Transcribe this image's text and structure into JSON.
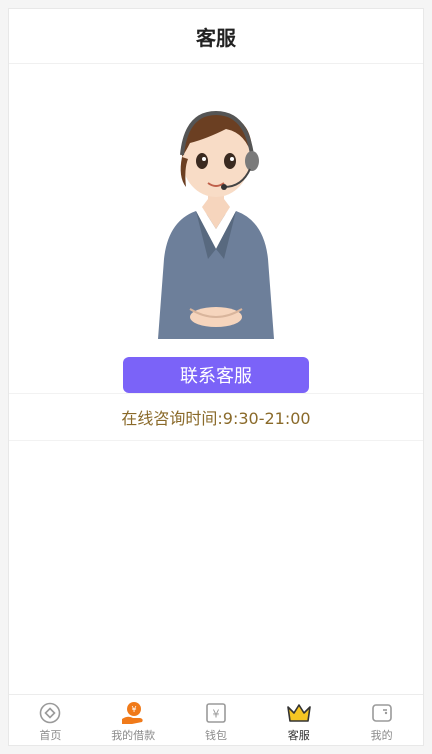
{
  "header": {
    "title": "客服"
  },
  "main": {
    "contact_button": "联系客服",
    "service_hours": "在线咨询时间:9:30-21:00"
  },
  "tabbar": {
    "items": [
      {
        "label": "首页",
        "icon": "home-icon",
        "active": false
      },
      {
        "label": "我的借款",
        "icon": "loan-icon",
        "active": false
      },
      {
        "label": "钱包",
        "icon": "wallet-icon",
        "active": false
      },
      {
        "label": "客服",
        "icon": "crown-icon",
        "active": true
      },
      {
        "label": "我的",
        "icon": "profile-icon",
        "active": false
      }
    ]
  },
  "colors": {
    "accent": "#7b63f8",
    "hours_text": "#8a6a2a",
    "loan_icon": "#f07a1a",
    "crown_icon": "#f6c623"
  }
}
